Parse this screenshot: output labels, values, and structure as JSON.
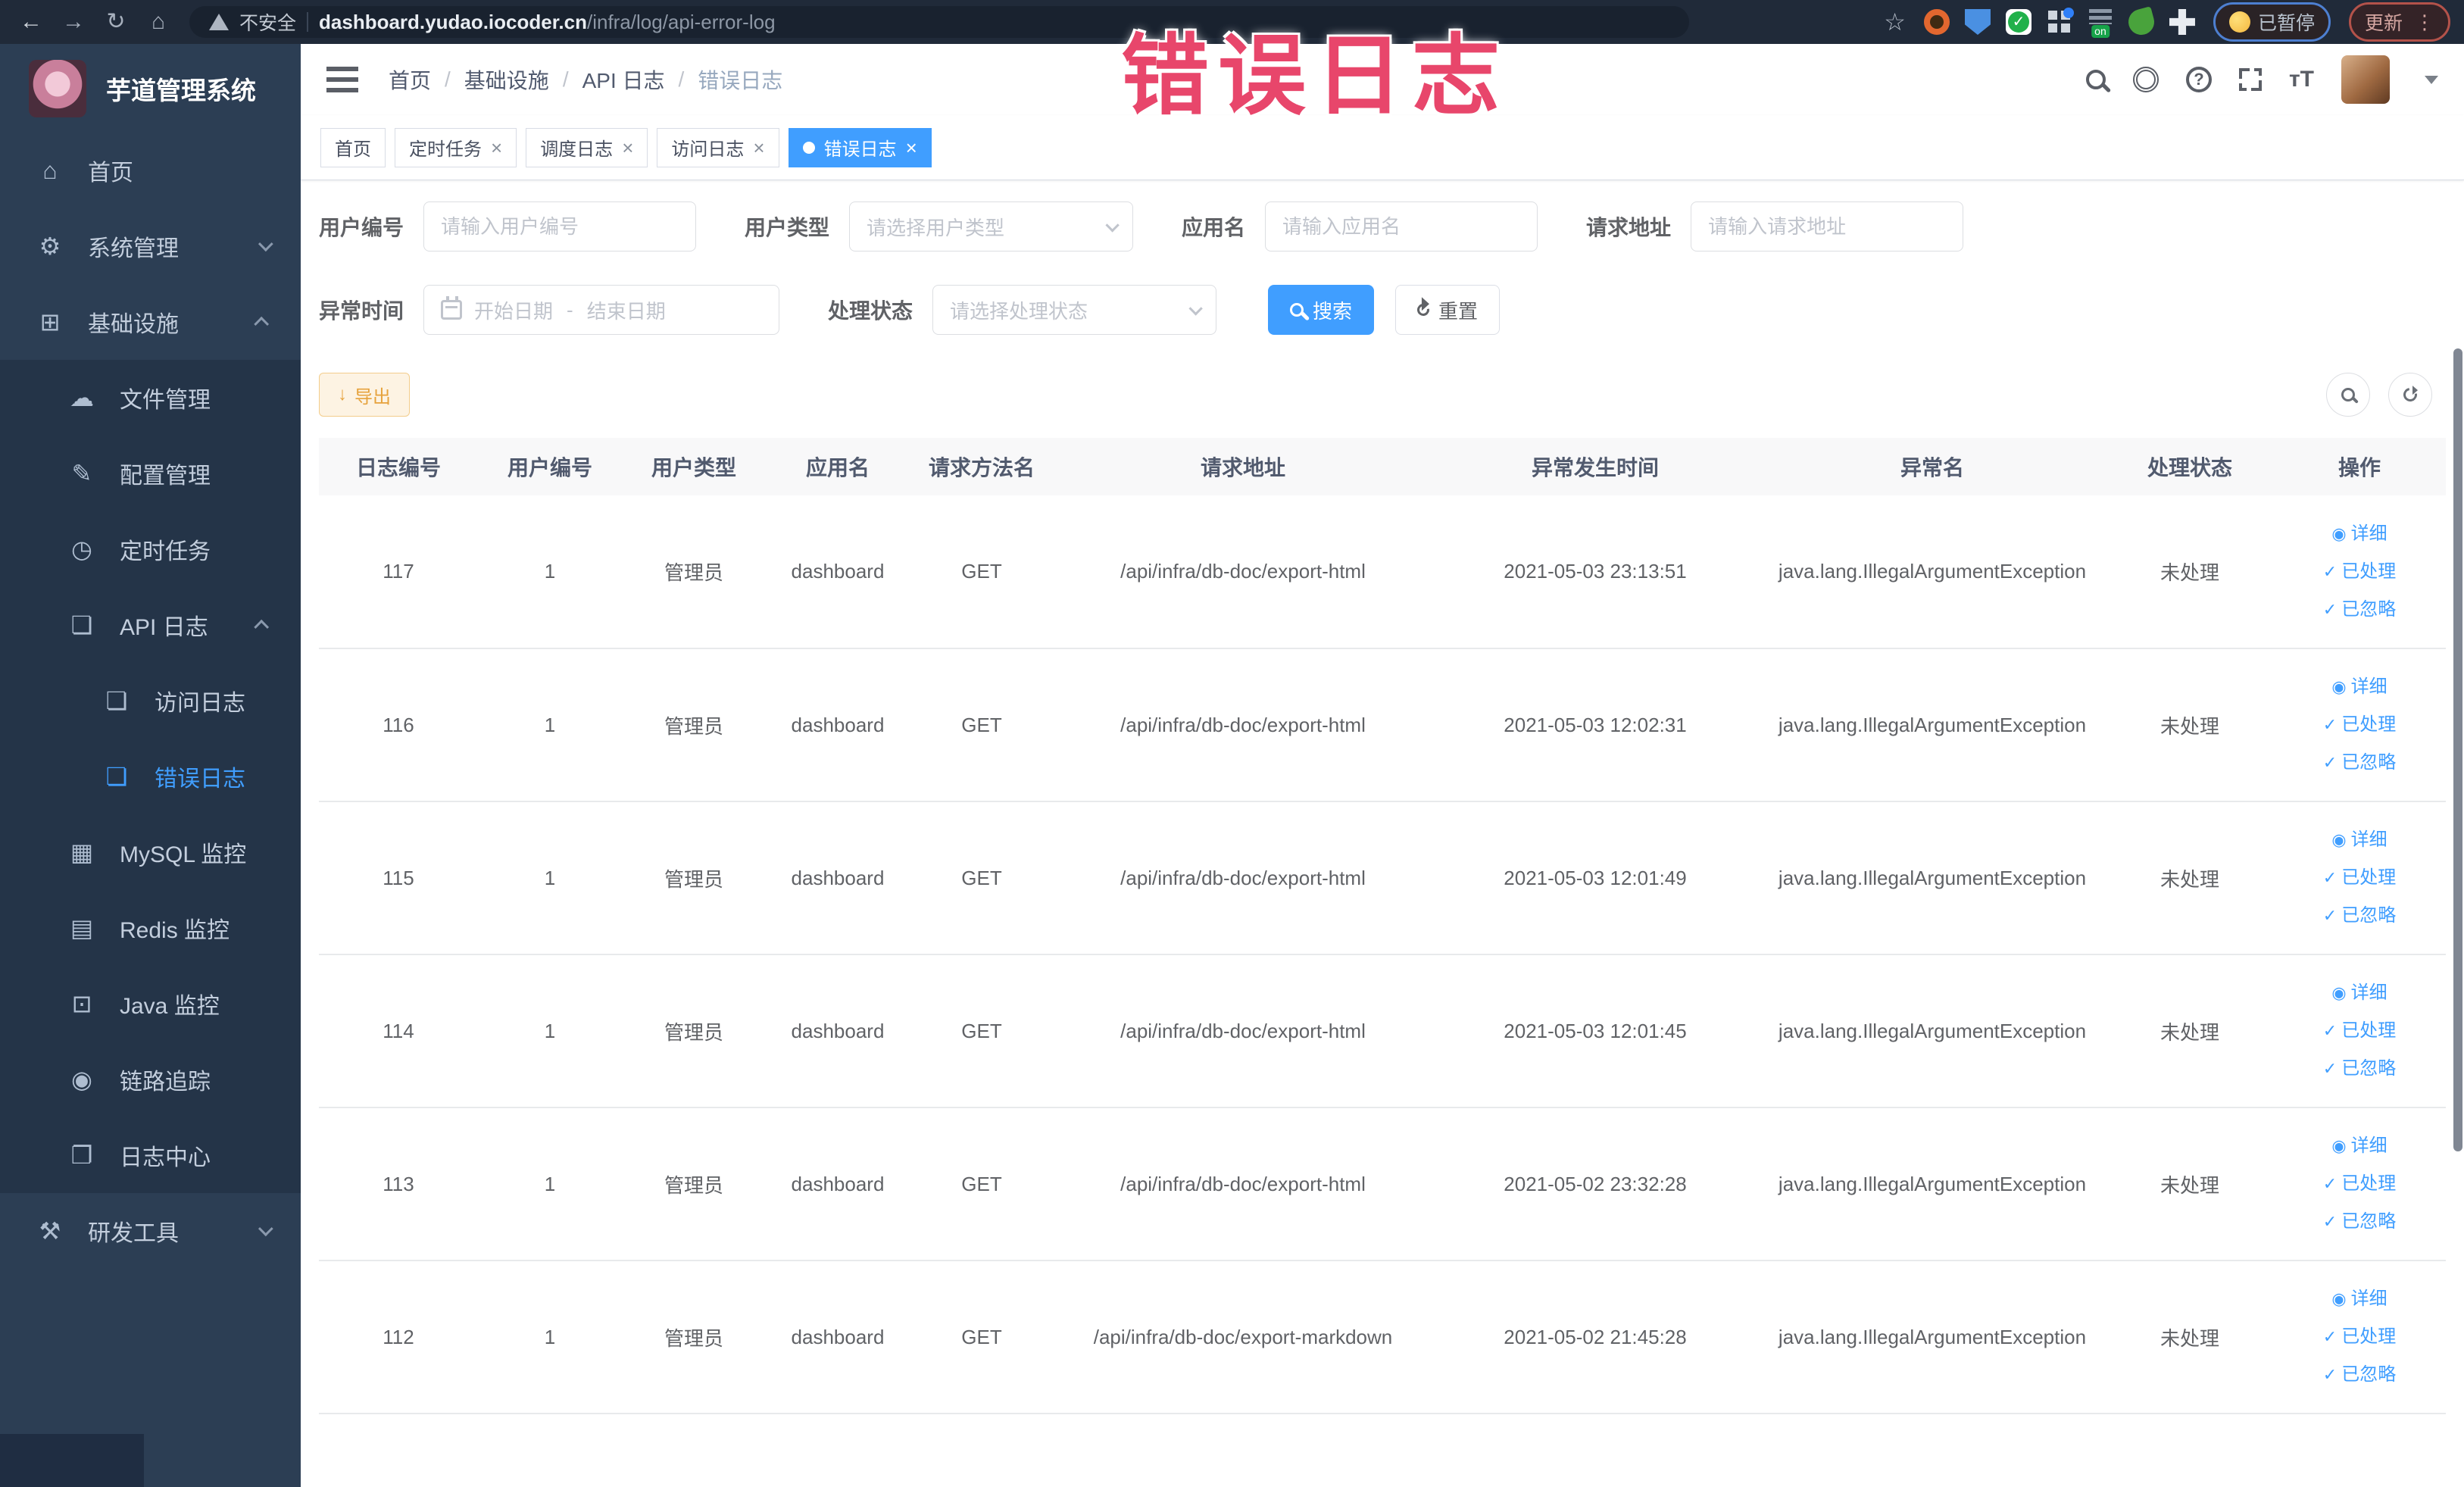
{
  "watermark": "错误日志",
  "browser": {
    "security_label": "不安全",
    "url_domain": "dashboard.yudao.iocoder.cn",
    "url_path": "/infra/log/api-error-log",
    "paused_label": "已暂停",
    "update_label": "更新",
    "extensions": [
      "ext-orange-icon",
      "ext-shield-icon",
      "ext-check-icon",
      "ext-grid-icon",
      "ext-on-badge-icon",
      "ext-leaf-icon",
      "ext-puzzle-icon"
    ]
  },
  "sidebar": {
    "logo_title": "芋道管理系统",
    "items": [
      {
        "label": "首页",
        "icon": "home-icon",
        "glyph": "⌂",
        "level": 0
      },
      {
        "label": "系统管理",
        "icon": "gear-icon",
        "glyph": "⚙",
        "level": 0,
        "chevron": "down"
      },
      {
        "label": "基础设施",
        "icon": "monitor-icon",
        "glyph": "⊞",
        "level": 0,
        "chevron": "up"
      },
      {
        "label": "文件管理",
        "icon": "cloud-upload-icon",
        "glyph": "☁",
        "level": 1
      },
      {
        "label": "配置管理",
        "icon": "edit-icon",
        "glyph": "✎",
        "level": 1
      },
      {
        "label": "定时任务",
        "icon": "timer-icon",
        "glyph": "◷",
        "level": 1
      },
      {
        "label": "API 日志",
        "icon": "api-log-icon",
        "glyph": "❏",
        "level": 1,
        "chevron": "up"
      },
      {
        "label": "访问日志",
        "icon": "access-log-icon",
        "glyph": "❏",
        "level": 2
      },
      {
        "label": "错误日志",
        "icon": "error-log-icon",
        "glyph": "❏",
        "level": 2,
        "active": true
      },
      {
        "label": "MySQL 监控",
        "icon": "mysql-icon",
        "glyph": "▦",
        "level": 1
      },
      {
        "label": "Redis 监控",
        "icon": "redis-icon",
        "glyph": "▤",
        "level": 1
      },
      {
        "label": "Java 监控",
        "icon": "java-icon",
        "glyph": "⊡",
        "level": 1
      },
      {
        "label": "链路追踪",
        "icon": "trace-icon",
        "glyph": "◉",
        "level": 1
      },
      {
        "label": "日志中心",
        "icon": "log-center-icon",
        "glyph": "❐",
        "level": 1
      },
      {
        "label": "研发工具",
        "icon": "toolbox-icon",
        "glyph": "⚒",
        "level": 0,
        "chevron": "down"
      }
    ]
  },
  "breadcrumb": [
    "首页",
    "基础设施",
    "API 日志",
    "错误日志"
  ],
  "tabs": [
    {
      "label": "首页",
      "closable": false,
      "active": false
    },
    {
      "label": "定时任务",
      "closable": true,
      "active": false
    },
    {
      "label": "调度日志",
      "closable": true,
      "active": false
    },
    {
      "label": "访问日志",
      "closable": true,
      "active": false
    },
    {
      "label": "错误日志",
      "closable": true,
      "active": true
    }
  ],
  "filters": {
    "user_id_label": "用户编号",
    "user_id_placeholder": "请输入用户编号",
    "user_type_label": "用户类型",
    "user_type_placeholder": "请选择用户类型",
    "app_name_label": "应用名",
    "app_name_placeholder": "请输入应用名",
    "request_url_label": "请求地址",
    "request_url_placeholder": "请输入请求地址",
    "exception_time_label": "异常时间",
    "date_start_placeholder": "开始日期",
    "date_separator": "-",
    "date_end_placeholder": "结束日期",
    "process_status_label": "处理状态",
    "process_status_placeholder": "请选择处理状态",
    "search_label": "搜索",
    "reset_label": "重置"
  },
  "toolbar": {
    "export_label": "导出"
  },
  "table": {
    "columns": [
      "日志编号",
      "用户编号",
      "用户类型",
      "应用名",
      "请求方法名",
      "请求地址",
      "异常发生时间",
      "异常名",
      "处理状态",
      "操作"
    ],
    "rows": [
      [
        "117",
        "1",
        "管理员",
        "dashboard",
        "GET",
        "/api/infra/db-doc/export-html",
        "2021-05-03 23:13:51",
        "java.lang.IllegalArgumentException",
        "未处理"
      ],
      [
        "116",
        "1",
        "管理员",
        "dashboard",
        "GET",
        "/api/infra/db-doc/export-html",
        "2021-05-03 12:02:31",
        "java.lang.IllegalArgumentException",
        "未处理"
      ],
      [
        "115",
        "1",
        "管理员",
        "dashboard",
        "GET",
        "/api/infra/db-doc/export-html",
        "2021-05-03 12:01:49",
        "java.lang.IllegalArgumentException",
        "未处理"
      ],
      [
        "114",
        "1",
        "管理员",
        "dashboard",
        "GET",
        "/api/infra/db-doc/export-html",
        "2021-05-03 12:01:45",
        "java.lang.IllegalArgumentException",
        "未处理"
      ],
      [
        "113",
        "1",
        "管理员",
        "dashboard",
        "GET",
        "/api/infra/db-doc/export-html",
        "2021-05-02 23:32:28",
        "java.lang.IllegalArgumentException",
        "未处理"
      ],
      [
        "112",
        "1",
        "管理员",
        "dashboard",
        "GET",
        "/api/infra/db-doc/export-markdown",
        "2021-05-02 21:45:28",
        "java.lang.IllegalArgumentException",
        "未处理"
      ]
    ],
    "row_actions": [
      "详细",
      "已处理",
      "已忽略"
    ]
  },
  "colors": {
    "primary": "#409eff",
    "warning": "#e6a23c",
    "watermark": "#e8466b"
  }
}
